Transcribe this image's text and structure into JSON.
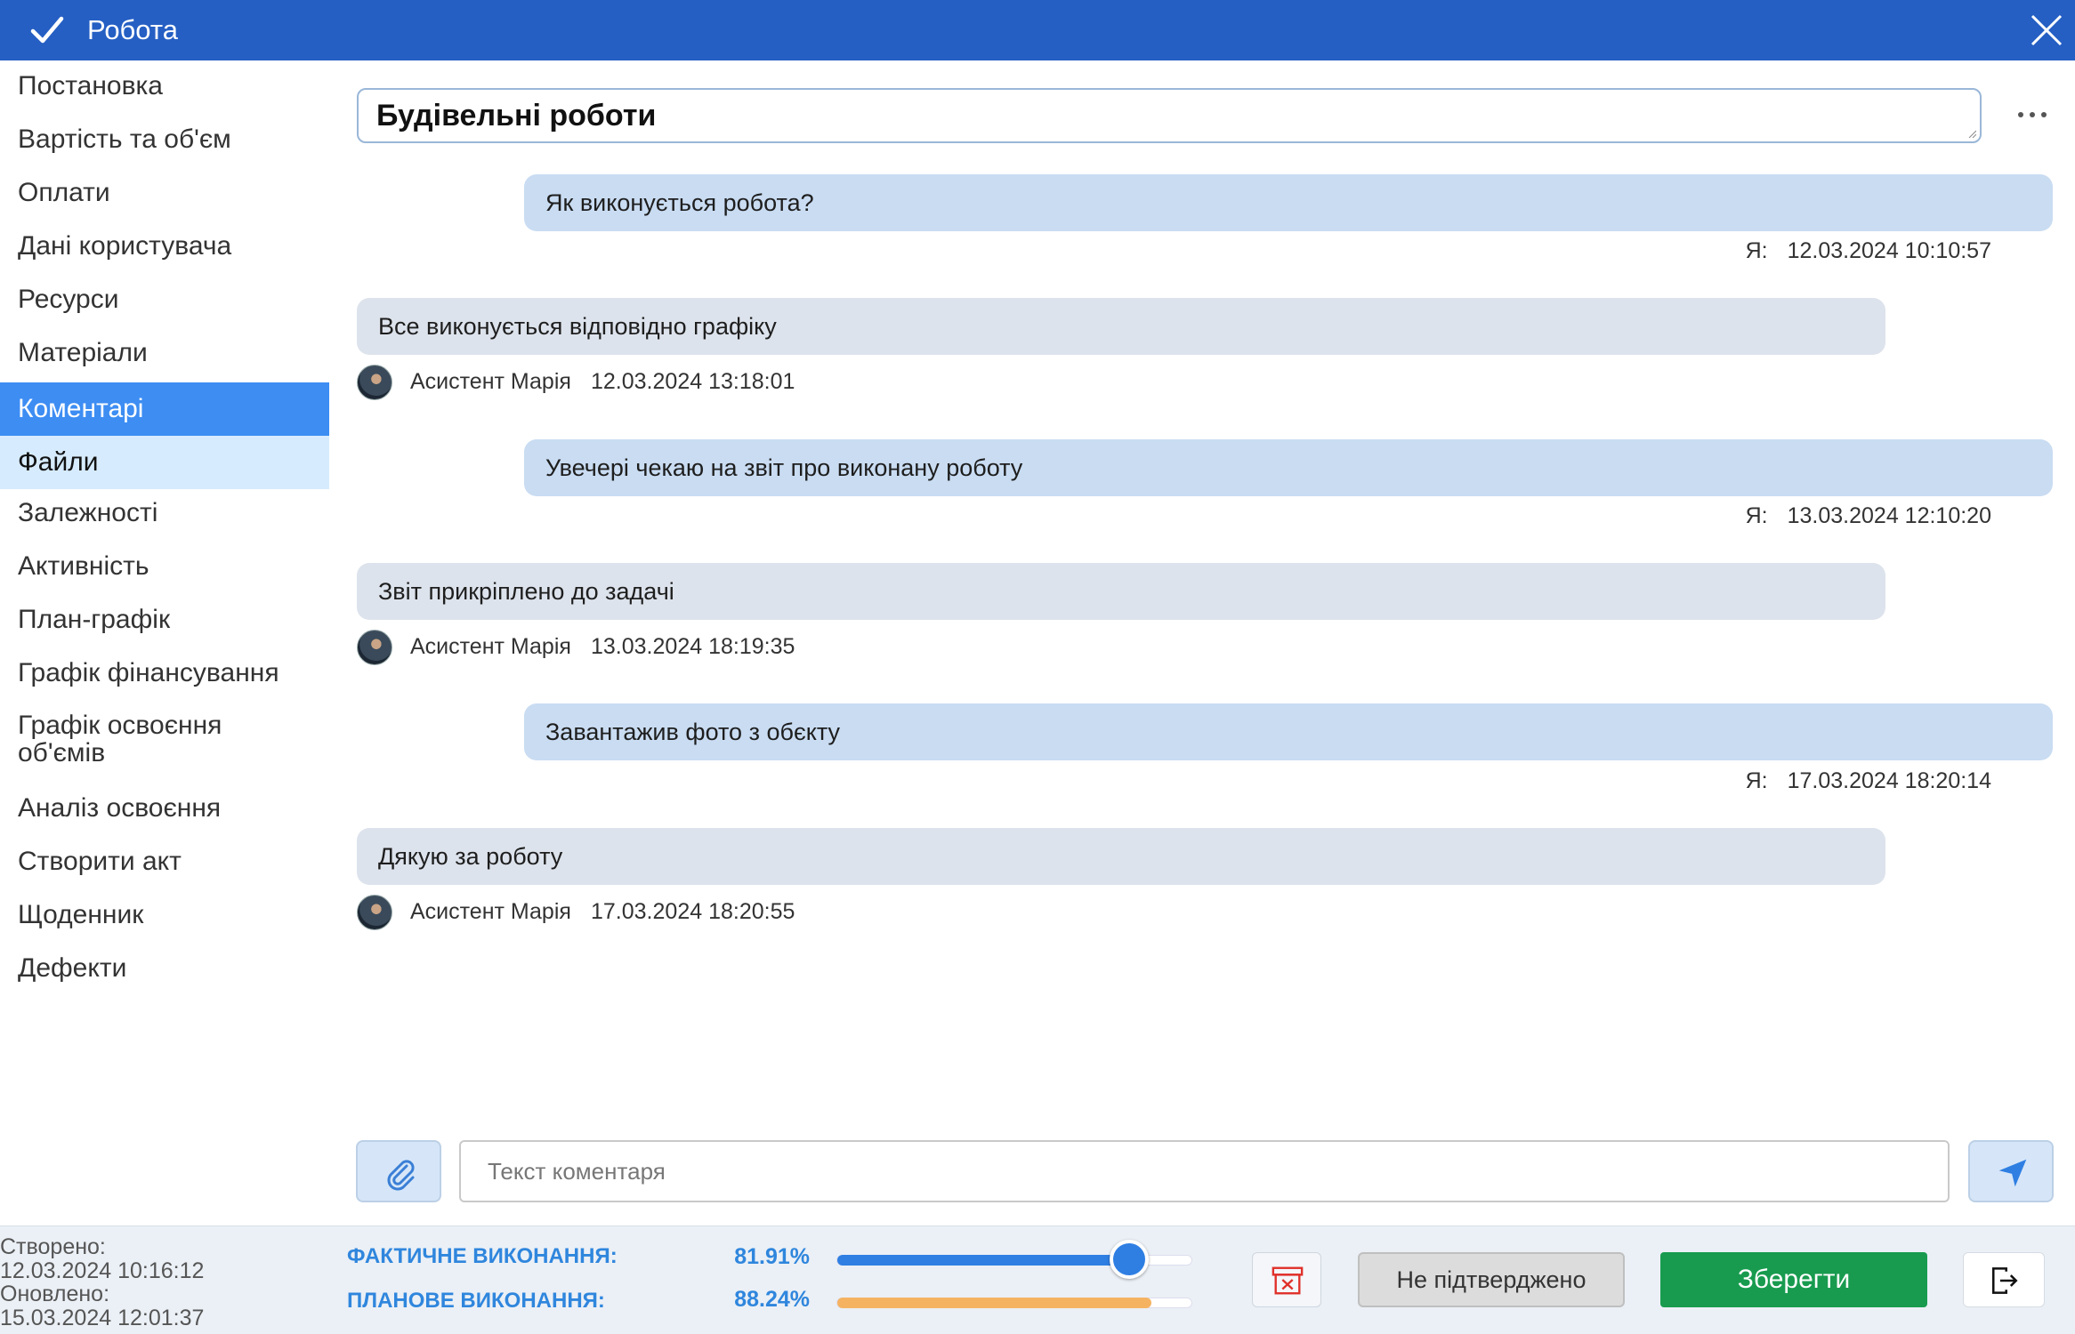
{
  "window": {
    "title": "Робота",
    "check_icon": "check-icon",
    "close_icon": "close-icon"
  },
  "sidebar": {
    "items": [
      {
        "label": "Постановка",
        "state": "normal"
      },
      {
        "label": "Вартість та об'єм",
        "state": "normal"
      },
      {
        "label": "Оплати",
        "state": "normal"
      },
      {
        "label": "Дані користувача",
        "state": "normal"
      },
      {
        "label": "Ресурси",
        "state": "normal"
      },
      {
        "label": "Матеріали",
        "state": "normal"
      },
      {
        "label": "Коментарі",
        "state": "active"
      },
      {
        "label": "Файли",
        "state": "hover"
      },
      {
        "label": "Залежності",
        "state": "normal"
      },
      {
        "label": "Активність",
        "state": "normal"
      },
      {
        "label": "План-графік",
        "state": "normal"
      },
      {
        "label": "Графік фінансування",
        "state": "normal"
      },
      {
        "label": "Графік освоєння",
        "state": "normal"
      },
      {
        "label": "об'ємів",
        "state": "normal"
      },
      {
        "label": "Аналіз освоєння",
        "state": "normal"
      },
      {
        "label": "Створити акт",
        "state": "normal"
      },
      {
        "label": "Щоденник",
        "state": "normal"
      },
      {
        "label": "Дефекти",
        "state": "normal"
      }
    ]
  },
  "task": {
    "name": "Будівельні роботи"
  },
  "comments": [
    {
      "mine": true,
      "text": "Як виконується робота?",
      "author": "Я:",
      "date": "12.03.2024 10:10:57"
    },
    {
      "mine": false,
      "text": "Все виконується відповідно графіку",
      "author": "Асистент Марія",
      "date": "12.03.2024 13:18:01"
    },
    {
      "mine": true,
      "text": "Увечері чекаю на звіт про виконану роботу",
      "author": "Я:",
      "date": "13.03.2024 12:10:20"
    },
    {
      "mine": false,
      "text": "Звіт прикріплено до задачі",
      "author": "Асистент Марія",
      "date": "13.03.2024 18:19:35"
    },
    {
      "mine": true,
      "text": "Завантажив фото з обєкту",
      "author": "Я:",
      "date": "17.03.2024 18:20:14"
    },
    {
      "mine": false,
      "text": "Дякую за роботу",
      "author": "Асистент Марія",
      "date": "17.03.2024 18:20:55"
    }
  ],
  "composer": {
    "placeholder": "Текст коментаря",
    "value": "",
    "attach_icon": "paperclip-icon",
    "send_icon": "send-icon"
  },
  "footer": {
    "created_label": "Створено:",
    "created_date": "12.03.2024 10:16:12",
    "updated_label": "Оновлено:",
    "updated_date": "15.03.2024 12:01:37",
    "actual_label": "ФАКТИЧНЕ ВИКОНАННЯ:",
    "actual_value": "81.91%",
    "actual_fraction": 0.8191,
    "planned_label": "ПЛАНОВЕ ВИКОНАННЯ:",
    "planned_value": "88.24%",
    "planned_fraction": 0.8824,
    "status_label": "Не підтверджено",
    "save_label": "Зберегти",
    "delete_icon": "archive-delete-icon",
    "exit_icon": "exit-icon"
  },
  "colors": {
    "titlebar": "#255fc4",
    "active_item": "#3d8df3",
    "hover_item": "#d6ebfd",
    "my_bubble": "#c9dcf2",
    "other_bubble": "#dde3ec",
    "accent_text": "#2f86dd",
    "save": "#189b4f",
    "planned_bar": "#f5b362",
    "delete_icon": "#e0302a"
  }
}
